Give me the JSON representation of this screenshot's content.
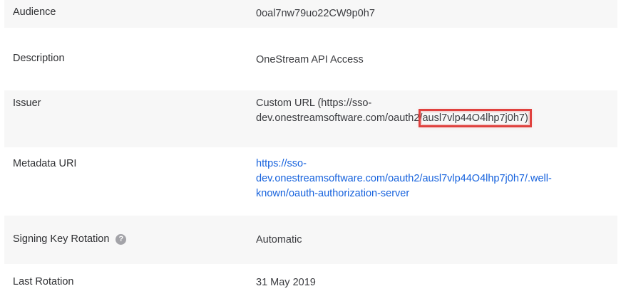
{
  "fields": {
    "audience": {
      "label": "Audience",
      "value": "0oal7nw79uo22CW9p0h7"
    },
    "description": {
      "label": "Description",
      "value": "OneStream API Access"
    },
    "issuer": {
      "label": "Issuer",
      "line1": "Custom URL (https://sso-",
      "line2_prefix": "dev.onestreamsoftware.com/oauth2/",
      "line2_highlight": "ausl7vlp44O4lhp7j0h7)"
    },
    "metadata_uri": {
      "label": "Metadata URI",
      "line1": "https://sso-",
      "line2": "dev.onestreamsoftware.com/oauth2/ausl7vlp44O4lhp7j0h7/.well-",
      "line3": "known/oauth-authorization-server"
    },
    "signing_key_rotation": {
      "label": "Signing Key Rotation",
      "help_glyph": "?",
      "value": "Automatic"
    },
    "last_rotation": {
      "label": "Last Rotation",
      "value": "31 May 2019"
    }
  },
  "colors": {
    "link": "#1662dd",
    "highlight_box": "#e0413e",
    "shaded_row": "#f7f7f7",
    "help_icon": "#a3a3a8"
  }
}
